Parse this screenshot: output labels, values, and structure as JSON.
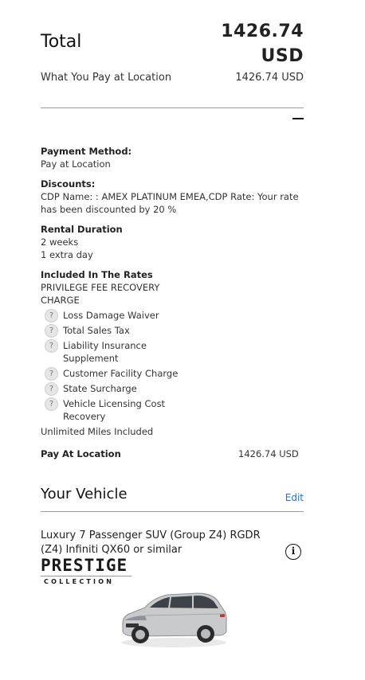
{
  "summary": {
    "total_label": "Total",
    "total_amount": "1426.74",
    "total_currency": "USD",
    "pay_location_label": "What You Pay at Location",
    "pay_location_value": "1426.74 USD"
  },
  "details": {
    "payment_method_title": "Payment Method:",
    "payment_method_value": "Pay at Location",
    "discounts_title": "Discounts:",
    "discounts_value": "CDP Name: : AMEX PLATINUM EMEA,CDP Rate: Your rate has been discounted by 20 %",
    "rental_duration_title": "Rental Duration",
    "rental_duration_lines": [
      "2 weeks",
      "1 extra day"
    ],
    "included_title": "Included In The Rates",
    "included_fee": "PRIVILEGE FEE RECOVERY CHARGE",
    "included_items": [
      "Loss Damage Waiver",
      "Total Sales Tax",
      "Liability Insurance Supplement",
      "Customer Facility Charge",
      "State Surcharge",
      "Vehicle Licensing Cost Recovery"
    ],
    "unlimited_miles": "Unlimited Miles Included",
    "pay_at_location_label": "Pay At Location",
    "pay_at_location_value": "1426.74 USD",
    "question_glyph": "?"
  },
  "vehicle": {
    "title": "Your Vehicle",
    "edit_label": "Edit",
    "description": "Luxury 7 Passenger SUV (Group Z4) RGDR (Z4) Infiniti QX60 or similar",
    "info_glyph": "i",
    "brand_main": "PRESTIGE",
    "brand_sub": "COLLECTION"
  },
  "colors": {
    "link": "#2a6fd6",
    "brand_line": "#c47ec0",
    "divider": "#9a9a9a"
  }
}
